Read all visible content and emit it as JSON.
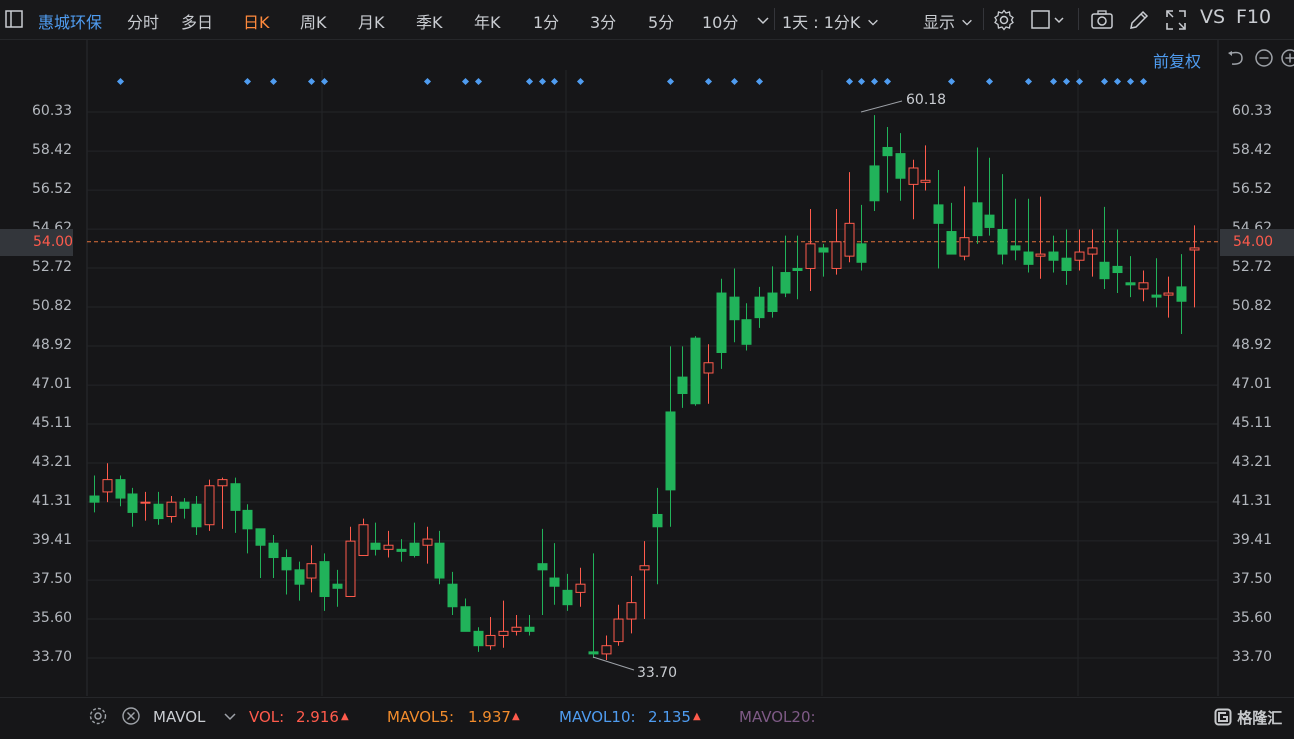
{
  "toolbar": {
    "stock_name": "惠城环保",
    "tabs": [
      "分时",
      "多日",
      "日K",
      "周K",
      "月K",
      "季K",
      "年K",
      "1分",
      "3分",
      "5分",
      "10分"
    ],
    "active_tab": "日K",
    "interval_select": "1天 : 1分K",
    "display_label": "显示",
    "vs_label": "VS",
    "f10_label": "F10"
  },
  "right_header": {
    "adjust_label": "前复权"
  },
  "price_axis": {
    "ticks": [
      "60.33",
      "58.42",
      "56.52",
      "54.62",
      "52.72",
      "50.82",
      "48.92",
      "47.01",
      "45.11",
      "43.21",
      "41.31",
      "39.41",
      "37.50",
      "35.60",
      "33.70"
    ]
  },
  "current_price": {
    "value": "54.00",
    "color": "#ff5b4c"
  },
  "annotations": {
    "high": "60.18",
    "low": "33.70"
  },
  "indicator_bar": {
    "name": "MAVOL",
    "vol_label": "VOL:",
    "vol_value": "2.916",
    "mavol5_label": "MAVOL5:",
    "mavol5_value": "1.937",
    "mavol10_label": "MAVOL10:",
    "mavol10_value": "2.135",
    "mavol20_label": "MAVOL20:"
  },
  "watermark": "格隆汇",
  "colors": {
    "up": "#ff5b4c",
    "down": "#21b35a",
    "background": "#161618",
    "marker": "#4f9cf0"
  },
  "chart_data": {
    "type": "candlestick",
    "ylim": [
      33.0,
      61.5
    ],
    "ticks": [
      60.33,
      58.42,
      56.52,
      54.62,
      52.72,
      50.82,
      48.92,
      47.01,
      45.11,
      43.21,
      41.31,
      39.41,
      37.5,
      35.6,
      33.7
    ],
    "reference_line": 54.0,
    "open": [
      41.6,
      41.8,
      42.4,
      41.7,
      41.3,
      41.2,
      40.6,
      41.3,
      41.2,
      40.2,
      42.1,
      42.2,
      40.9,
      40.0,
      39.3,
      38.6,
      38.0,
      37.6,
      38.4,
      37.3,
      36.7,
      38.7,
      39.3,
      39.0,
      39.0,
      39.3,
      39.2,
      39.3,
      37.3,
      36.2,
      35.0,
      34.3,
      34.8,
      35.0,
      35.2,
      38.3,
      37.6,
      37.0,
      36.9,
      34.0,
      33.9,
      34.5,
      35.6,
      38.0,
      40.7,
      45.7,
      47.4,
      49.3,
      47.6,
      51.5,
      51.3,
      50.2,
      51.3,
      51.5,
      52.5,
      52.7,
      52.7,
      53.7,
      52.7,
      53.3,
      53.9,
      57.7,
      58.6,
      58.3,
      56.8,
      56.9,
      55.8,
      54.5,
      53.3,
      55.9,
      55.3,
      54.6,
      53.8,
      53.5,
      53.3,
      53.5,
      53.2,
      53.1,
      53.4,
      53.0,
      52.8,
      52.0,
      51.7,
      51.4,
      51.4,
      51.8,
      53.6
    ],
    "close": [
      41.3,
      42.4,
      41.5,
      40.8,
      41.3,
      40.5,
      41.3,
      41.0,
      40.1,
      42.1,
      42.4,
      40.9,
      40.0,
      39.2,
      38.6,
      38.0,
      37.3,
      38.3,
      36.7,
      37.1,
      39.4,
      40.2,
      39.0,
      39.2,
      38.9,
      38.7,
      39.5,
      37.6,
      36.2,
      35.0,
      34.3,
      34.8,
      35.0,
      35.2,
      35.0,
      38.0,
      37.2,
      36.3,
      37.3,
      33.9,
      34.3,
      35.6,
      36.4,
      38.2,
      40.1,
      41.9,
      46.6,
      46.1,
      48.1,
      48.6,
      50.2,
      49.0,
      50.3,
      50.6,
      51.5,
      52.6,
      53.9,
      53.5,
      54.0,
      54.9,
      53.0,
      56.0,
      58.2,
      57.1,
      57.6,
      57.0,
      54.9,
      53.4,
      54.2,
      54.3,
      54.7,
      53.4,
      53.6,
      52.9,
      53.4,
      53.1,
      52.6,
      53.5,
      53.7,
      52.2,
      52.5,
      51.9,
      52.0,
      51.3,
      51.5,
      51.1,
      53.7
    ],
    "high": [
      42.6,
      43.2,
      42.6,
      42.0,
      41.8,
      41.8,
      41.6,
      41.5,
      41.6,
      42.4,
      42.5,
      42.5,
      41.2,
      40.0,
      39.7,
      39.0,
      38.4,
      39.2,
      38.8,
      38.0,
      40.1,
      40.5,
      40.3,
      39.9,
      39.5,
      40.3,
      40.1,
      39.9,
      37.9,
      36.6,
      35.2,
      35.7,
      36.5,
      35.8,
      35.8,
      40.0,
      39.3,
      37.8,
      38.1,
      38.8,
      34.8,
      36.3,
      37.7,
      39.4,
      42.0,
      48.9,
      48.9,
      49.4,
      49.0,
      52.2,
      52.7,
      51.0,
      51.8,
      52.8,
      54.3,
      54.3,
      55.6,
      53.9,
      55.6,
      57.4,
      55.8,
      60.18,
      59.6,
      59.3,
      58.0,
      58.7,
      57.5,
      55.9,
      56.7,
      58.6,
      58.1,
      57.3,
      56.1,
      56.1,
      56.2,
      54.3,
      54.6,
      54.6,
      54.6,
      55.7,
      54.6,
      53.3,
      52.6,
      53.2,
      52.3,
      53.4,
      54.8
    ],
    "low": [
      40.8,
      41.3,
      41.1,
      40.1,
      40.4,
      40.2,
      40.3,
      40.5,
      39.7,
      39.9,
      40.0,
      39.8,
      38.8,
      37.6,
      37.6,
      36.8,
      36.5,
      36.9,
      36.0,
      36.2,
      36.8,
      38.8,
      38.7,
      38.6,
      38.4,
      38.6,
      38.3,
      37.3,
      35.8,
      35.0,
      34.0,
      34.1,
      34.2,
      34.8,
      34.8,
      35.8,
      36.3,
      36.0,
      36.2,
      33.7,
      33.6,
      34.3,
      34.9,
      35.6,
      37.3,
      40.1,
      45.9,
      46.0,
      46.1,
      47.8,
      49.1,
      48.7,
      49.8,
      50.3,
      51.3,
      51.2,
      51.6,
      52.3,
      52.4,
      53.0,
      52.6,
      55.5,
      56.4,
      56.0,
      55.1,
      56.5,
      52.7,
      53.4,
      53.1,
      53.9,
      54.3,
      52.9,
      53.1,
      52.5,
      52.2,
      52.5,
      51.9,
      52.6,
      52.3,
      51.7,
      51.5,
      51.3,
      51.1,
      50.8,
      50.3,
      49.5,
      50.8
    ]
  }
}
